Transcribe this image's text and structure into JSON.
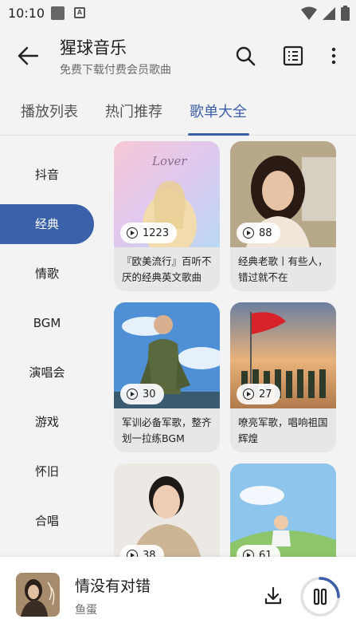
{
  "status": {
    "time": "10:10",
    "a_badge": "A"
  },
  "header": {
    "title": "猩球音乐",
    "subtitle": "免费下载付费会员歌曲"
  },
  "tabs": [
    {
      "label": "播放列表"
    },
    {
      "label": "热门推荐"
    },
    {
      "label": "歌单大全",
      "active": true
    }
  ],
  "sidebar": {
    "items": [
      {
        "label": "抖音"
      },
      {
        "label": "经典",
        "active": true
      },
      {
        "label": "情歌"
      },
      {
        "label": "BGM"
      },
      {
        "label": "演唱会"
      },
      {
        "label": "游戏"
      },
      {
        "label": "怀旧"
      },
      {
        "label": "合唱"
      }
    ]
  },
  "playlists": [
    {
      "count": "1223",
      "desc": "『欧美流行』百听不厌的经典英文歌曲",
      "cover_text": "Lover"
    },
    {
      "count": "88",
      "desc": "经典老歌丨有些人，错过就不在"
    },
    {
      "count": "30",
      "desc": "军训必备军歌，整齐划一拉练BGM"
    },
    {
      "count": "27",
      "desc": "嘹亮军歌，唱响祖国辉煌"
    },
    {
      "count": "38",
      "desc": ""
    },
    {
      "count": "61",
      "desc": ""
    }
  ],
  "player": {
    "song": "情没有对错",
    "artist": "鱼蛋",
    "progress": 0.25
  },
  "colors": {
    "accent": "#3d5fa8",
    "sidebar_active": "#3b62a8",
    "background": "#f3f3f3"
  }
}
